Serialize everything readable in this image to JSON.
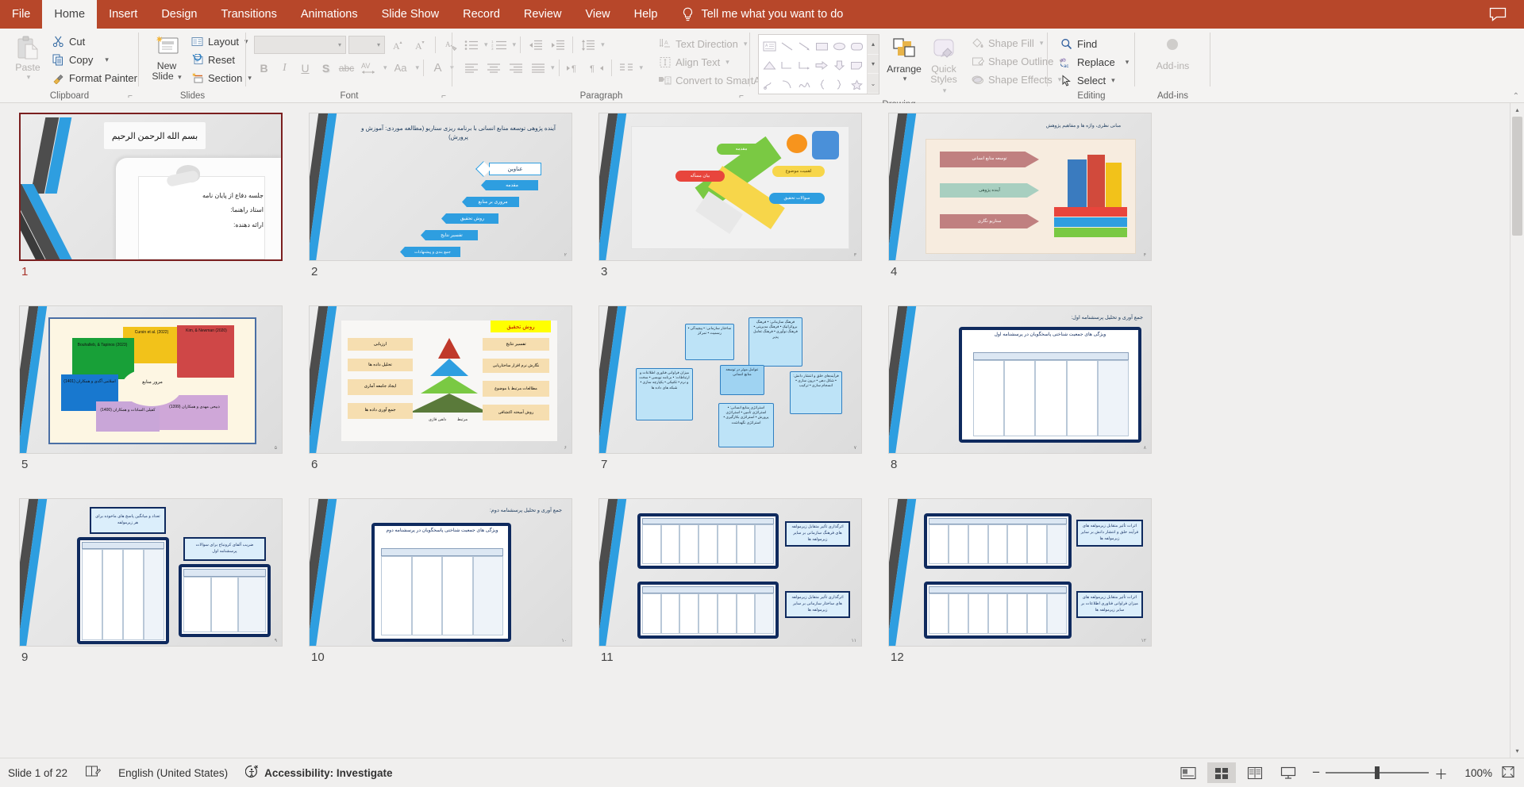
{
  "app": {
    "tabs": [
      {
        "label": "File",
        "active": false
      },
      {
        "label": "Home",
        "active": true
      },
      {
        "label": "Insert",
        "active": false
      },
      {
        "label": "Design",
        "active": false
      },
      {
        "label": "Transitions",
        "active": false
      },
      {
        "label": "Animations",
        "active": false
      },
      {
        "label": "Slide Show",
        "active": false
      },
      {
        "label": "Record",
        "active": false
      },
      {
        "label": "Review",
        "active": false
      },
      {
        "label": "View",
        "active": false
      },
      {
        "label": "Help",
        "active": false
      }
    ],
    "tellme": "Tell me what you want to do"
  },
  "ribbon": {
    "clipboard": {
      "label": "Clipboard",
      "paste": "Paste",
      "cut": "Cut",
      "copy": "Copy",
      "format_painter": "Format Painter"
    },
    "slides": {
      "label": "Slides",
      "new_slide_line1": "New",
      "new_slide_line2": "Slide",
      "layout": "Layout",
      "reset": "Reset",
      "section": "Section"
    },
    "font": {
      "label": "Font",
      "font_name": "",
      "font_size": "",
      "bold": "B",
      "italic": "I",
      "underline": "U",
      "shadow": "S",
      "strikethrough": "abc",
      "char_spacing": "AV",
      "change_case": "Aa",
      "font_color": "A",
      "grow_font": "A",
      "shrink_font": "A",
      "clear_formatting": "A"
    },
    "paragraph": {
      "label": "Paragraph",
      "text_direction": "Text Direction",
      "align_text": "Align Text",
      "convert_to_smartart": "Convert to SmartArt"
    },
    "drawing": {
      "label": "Drawing",
      "arrange": "Arrange",
      "quick_styles_line1": "Quick",
      "quick_styles_line2": "Styles",
      "shape_fill": "Shape Fill",
      "shape_outline": "Shape Outline",
      "shape_effects": "Shape Effects"
    },
    "editing": {
      "label": "Editing",
      "find": "Find",
      "replace": "Replace",
      "select": "Select"
    },
    "addins": {
      "label": "Add-ins",
      "addins_button": "Add-ins"
    }
  },
  "status": {
    "slide_counter": "Slide 1 of 22",
    "language": "English (United States)",
    "accessibility": "Accessibility: Investigate",
    "zoom_level": "100%",
    "views": [
      "normal-view",
      "slide-sorter-view",
      "reading-view",
      "slide-show-view"
    ],
    "active_view": "slide-sorter-view"
  },
  "slides": [
    {
      "number": "1",
      "selected": true,
      "type": "title",
      "bismillah": "بسم الله الرحمن الرحیم",
      "lines": [
        "جلسه دفاع از پایان نامه",
        "استاد راهنما:",
        "ارائه دهنده:"
      ],
      "page_marker": ""
    },
    {
      "number": "2",
      "selected": false,
      "type": "agenda",
      "title": "آینده پژوهی توسعه منابع انسانی با برنامه ریزی سناریو (مطالعه موردی: آموزش و پرورش)",
      "header_chip": "عناوین",
      "items": [
        "مقدمه",
        "مروری بر منابع",
        "روش تحقیق",
        "تفسیر نتایج",
        "جمع بندی و پیشنهادات"
      ],
      "page_marker": "۲"
    },
    {
      "number": "3",
      "selected": false,
      "type": "pencil",
      "labels": [
        "مقدمه",
        "بیان مسأله",
        "اهمیت موضوع",
        "سوالات تحقیق"
      ],
      "page_marker": "۳"
    },
    {
      "number": "4",
      "selected": false,
      "type": "books",
      "title": "مبانی نظری، واژه ها و مفاهیم پژوهش",
      "chips": [
        "توسعه منابع انسانی",
        "آینده پژوهی",
        "سناریو نگاری"
      ],
      "page_marker": "۴"
    },
    {
      "number": "5",
      "selected": false,
      "type": "pie3d",
      "center_label": "مرور منابع",
      "segments": [
        {
          "label": "Cursin et al. (2022)",
          "color": "#f2c21a"
        },
        {
          "label": "Kim, & Newman (2020)",
          "color": "#cf4747"
        },
        {
          "label": "Bouhalleb, & Tapinos (2023)",
          "color": "#18a038"
        },
        {
          "label": "اسلامی آگدی و همکاران (1401)",
          "color": "#1878cf"
        },
        {
          "label": "کفیلی السادات و همکاران (1400)",
          "color": "#c9a6d8"
        },
        {
          "label": "ذبیحی مهدی و همکاران (1399)",
          "color": "#cfa7d8"
        }
      ],
      "page_marker": "۵"
    },
    {
      "number": "6",
      "selected": false,
      "type": "pyramid",
      "title": "روش تحقیق",
      "left_items": [
        "ارزیابی",
        "تحلیل داده ها",
        "ایجاد جامعه آماری",
        "جمع آوری داده ها"
      ],
      "right_items": [
        "تفسیر نتایج",
        "نگارش نرم افزار ساختاریابی",
        "مطالعات مرتبط با موضوع",
        "روش آمیخته اکتشافی"
      ],
      "bottom_labels": [
        "دلفی فازی",
        "مرتبط"
      ],
      "page_marker": "۶"
    },
    {
      "number": "7",
      "selected": false,
      "type": "mindmap",
      "center": "عوامل موثر در توسعه منابع انسانی",
      "nodes": [
        "ساختار سازمانی: • پیچیدگی • رسمیت • تمرکز",
        "فرهنگ سازمانی: • فرهنگ بروکراتیک • فرهنگ مدیریتی • فرهنگ نوآوری • فرهنگ تعامل پذیر",
        "فرآیندهای خلق و انتشار دانش: • شکل دهی • درون سازی • انسجام سازی • ترکیب",
        "میزان فراوانی فناوری اطلاعات و ارتباطات: • برنامه نویسی • سخت و نرم • تکنیکی • یکپارچه سازی • شبکه های داده ها",
        "استراتژی منابع انسانی: • استراتژی تأمین • استراتژی پرورش • استراتژی بکارگیری • استراتژی نگهداشت"
      ],
      "page_marker": "۷"
    },
    {
      "number": "8",
      "selected": false,
      "type": "table",
      "title": "جمع آوری و تحلیل پرسشنامه اول:",
      "subtitle": "ویژگی های جمعیت شناختی پاسخگویان در پرسشنامه اول",
      "page_marker": "۸"
    },
    {
      "number": "9",
      "selected": false,
      "type": "twotables",
      "callout1": "تعداد و میانگین پاسخ های ماخوذه برای هر زیرمولفه",
      "callout2": "ضریب آلفای کرونباخ برای سوالات پرسشنامه اول",
      "page_marker": "۹"
    },
    {
      "number": "10",
      "selected": false,
      "type": "table",
      "title": "جمع آوری و تحلیل پرسشنامه دوم:",
      "subtitle": "ویژگی های جمعیت شناختی پاسخگویان در پرسشنامه دوم",
      "page_marker": "۱۰"
    },
    {
      "number": "11",
      "selected": false,
      "type": "tablecallout",
      "callout1": "اثرگذاری تأثیر متقابل زیرمولفه های فرهنگ سازمانی بر سایر زیرمولفه ها",
      "callout2": "اثرگذاری تأثیر متقابل زیرمولفه های ساختار سازمانی بر سایر زیرمولفه ها",
      "page_marker": "۱۱"
    },
    {
      "number": "12",
      "selected": false,
      "type": "tablecallout",
      "callout1": "اثرات تأثیر متقابل زیرمولفه های فرآیند خلق و انتشار دانش بر سایر زیرمولفه ها",
      "callout2": "اثرات تأثیر متقابل زیرمولفه های میزان فراوانی فناوری اطلاعات بر سایر زیرمولفه ها",
      "page_marker": "۱۲"
    }
  ],
  "colors": {
    "ribbon_accent": "#b7472a",
    "selection": "#7b1f1f",
    "slide_blue": "#2e9ee0",
    "navy": "#0f2a5e"
  }
}
